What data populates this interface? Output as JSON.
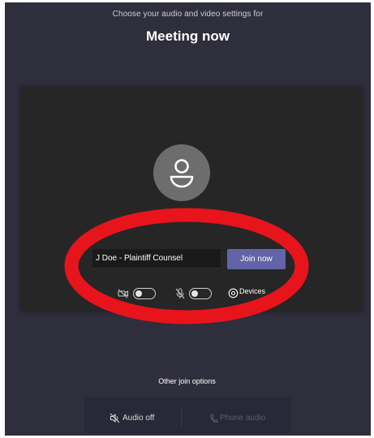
{
  "header": {
    "subtitle": "Choose your audio and video settings for",
    "title": "Meeting now"
  },
  "preview": {
    "avatar_icon": "person-icon",
    "name_input_value": "J Doe - Plaintiff Counsel",
    "join_label": "Join now",
    "join_color": "#6264a7",
    "controls": {
      "camera_icon": "camera-off-icon",
      "camera_on": false,
      "mic_icon": "mic-off-icon",
      "mic_on": false,
      "devices_icon": "gear-icon",
      "devices_label": "Devices"
    }
  },
  "other_options": {
    "label": "Other join options",
    "audio_off_icon": "speaker-off-icon",
    "audio_off_label": "Audio off",
    "phone_audio_icon": "phone-icon",
    "phone_audio_label": "Phone audio"
  },
  "annotation": {
    "shape": "ellipse",
    "color": "#e8141c"
  }
}
